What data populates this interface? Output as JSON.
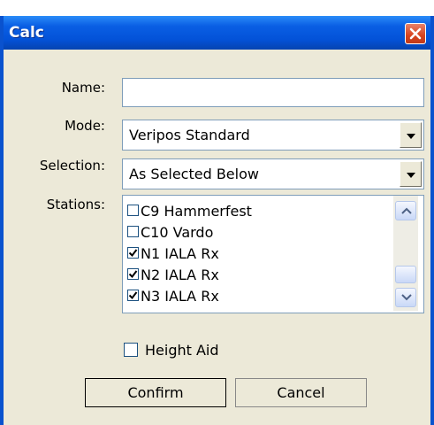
{
  "window": {
    "title": "Calc"
  },
  "form": {
    "name_label": "Name:",
    "name_value": "",
    "mode_label": "Mode:",
    "mode_value": "Veripos Standard",
    "selection_label": "Selection:",
    "selection_value": "As Selected Below",
    "stations_label": "Stations:",
    "stations": [
      {
        "label": "C9 Hammerfest",
        "checked": false
      },
      {
        "label": "C10 Vardo",
        "checked": false
      },
      {
        "label": "N1 IALA Rx",
        "checked": true
      },
      {
        "label": "N2 IALA Rx",
        "checked": true
      },
      {
        "label": "N3 IALA Rx",
        "checked": true
      }
    ],
    "height_aid_label": "Height Aid",
    "height_aid_checked": false
  },
  "buttons": {
    "confirm": "Confirm",
    "cancel": "Cancel"
  },
  "icons": {
    "close": "close-icon",
    "dropdown": "chevron-down-icon",
    "scroll_up": "chevron-up-icon",
    "scroll_down": "chevron-down-icon",
    "check": "checkmark-icon"
  },
  "colors": {
    "titlebar": "#0A5FE4",
    "window_bg": "#ECE9D8",
    "close_button": "#D8431E"
  }
}
